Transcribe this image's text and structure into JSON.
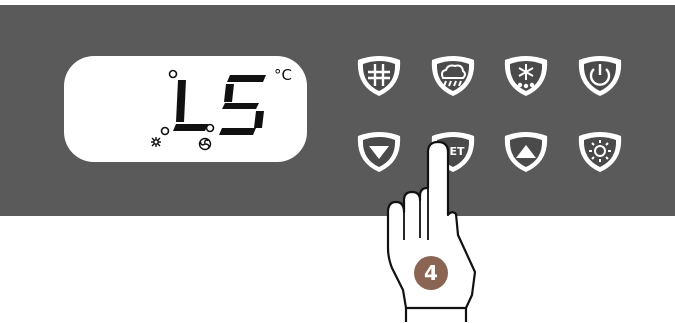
{
  "display": {
    "reading": "LS",
    "unit": "°C",
    "indicators": [
      "snowflake-indicator",
      "fan-indicator"
    ]
  },
  "buttons": [
    {
      "id": "defrost",
      "icon": "defrost-icon"
    },
    {
      "id": "humidity",
      "icon": "cloud-rain-icon"
    },
    {
      "id": "snow",
      "icon": "snowflake-icon"
    },
    {
      "id": "power",
      "icon": "power-icon"
    },
    {
      "id": "down",
      "icon": "arrow-down-icon"
    },
    {
      "id": "set",
      "label": "SET"
    },
    {
      "id": "up",
      "icon": "arrow-up-icon"
    },
    {
      "id": "light",
      "icon": "sun-icon"
    }
  ],
  "step_badge": "4",
  "colors": {
    "panel": "#5a5a5a",
    "display_bg": "#ffffff",
    "badge": "#8a6553"
  }
}
